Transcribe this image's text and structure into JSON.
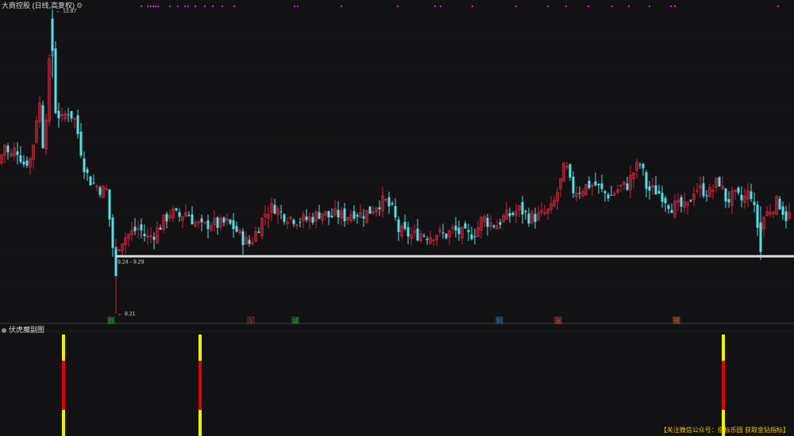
{
  "main_panel": {
    "title": "大商控股 (日线,高复权)",
    "price_high_label": "13.87",
    "price_low_label": "8.21",
    "range_label": "9.24 - 9.29",
    "event_markers": [
      "跌",
      "1",
      "减",
      "利",
      "涨",
      "预"
    ],
    "event_colors": [
      "#3cb043",
      "#e03030",
      "#3cb043",
      "#3a80d8",
      "#e05050",
      "#e07030"
    ]
  },
  "sub_panel": {
    "title": "伏虎魔副图"
  },
  "footer": {
    "text": "【关注微信公众号：指标乐园 获取金钻指标】"
  },
  "colors": {
    "up": "#d0213a",
    "down": "#54e0e8",
    "level_line": "#d8d8d8",
    "marker_dots": "#d020d0",
    "signal_yellow": "#f2f200",
    "signal_red": "#e00000",
    "background": "#121214"
  },
  "chart_data": {
    "type": "candlestick",
    "y_range": [
      8.21,
      13.87
    ],
    "high": 13.87,
    "low": 8.21,
    "support_band": [
      9.24,
      9.29
    ]
  }
}
